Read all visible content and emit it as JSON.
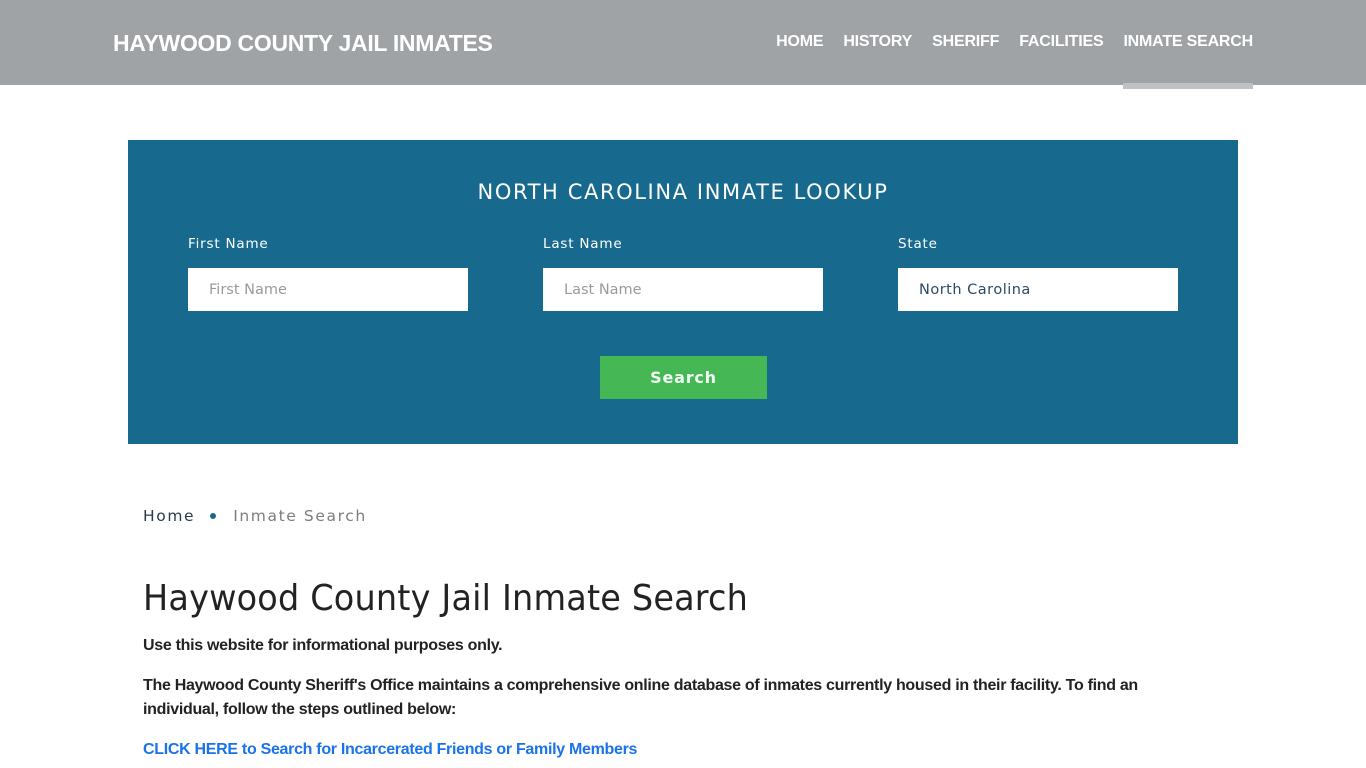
{
  "header": {
    "site_title": "HAYWOOD COUNTY JAIL INMATES",
    "nav": [
      {
        "label": "HOME",
        "active": false
      },
      {
        "label": "HISTORY",
        "active": false
      },
      {
        "label": "SHERIFF",
        "active": false
      },
      {
        "label": "FACILITIES",
        "active": false
      },
      {
        "label": "INMATE SEARCH",
        "active": true
      }
    ]
  },
  "lookup": {
    "title": "NORTH CAROLINA INMATE LOOKUP",
    "first_name": {
      "label": "First Name",
      "placeholder": "First Name",
      "value": ""
    },
    "last_name": {
      "label": "Last Name",
      "placeholder": "Last Name",
      "value": ""
    },
    "state": {
      "label": "State",
      "value": "North Carolina"
    },
    "search_button": "Search"
  },
  "breadcrumb": {
    "home": "Home",
    "current": "Inmate Search"
  },
  "content": {
    "title": "Haywood County Jail Inmate Search",
    "intro": "Use this website for informational purposes only.",
    "description": "The Haywood County Sheriff's Office maintains a comprehensive online database of inmates currently housed in their facility. To find an individual, follow the steps outlined below:",
    "cta_link": "CLICK HERE to Search for Incarcerated Friends or Family Members"
  },
  "colors": {
    "header_bg": "#9fa3a6",
    "panel_bg": "#176a8d",
    "button_bg": "#45b855",
    "link": "#1a73e8"
  }
}
